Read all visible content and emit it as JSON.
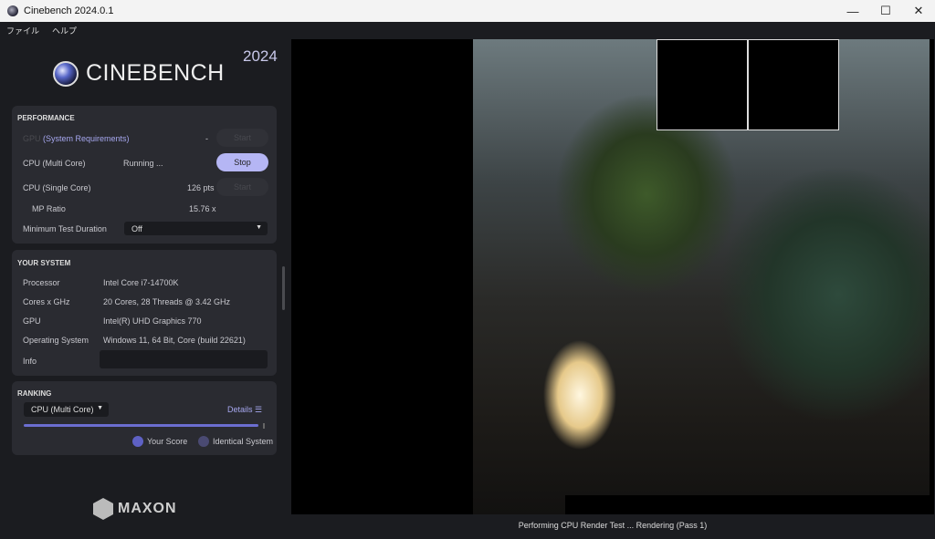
{
  "window": {
    "title": "Cinebench 2024.0.1",
    "minimize": "—",
    "maximize": "☐",
    "close": "✕"
  },
  "menu": [
    "ファイル",
    "ヘルプ"
  ],
  "brand": {
    "name": "CINEBENCH",
    "year": "2024",
    "footer": "MAXON"
  },
  "performance": {
    "heading": "PERFORMANCE",
    "gpu": {
      "label": "GPU",
      "link": "(System Requirements)",
      "value": "-",
      "button": "Start"
    },
    "multi": {
      "label": "CPU (Multi Core)",
      "value": "Running ...",
      "button": "Stop"
    },
    "single": {
      "label": "CPU (Single Core)",
      "value": "126 pts",
      "button": "Start"
    },
    "mp": {
      "label": "MP Ratio",
      "value": "15.76 x"
    },
    "duration": {
      "label": "Minimum Test Duration",
      "value": "Off"
    }
  },
  "system": {
    "heading": "YOUR SYSTEM",
    "rows": [
      {
        "label": "Processor",
        "value": "Intel Core i7-14700K"
      },
      {
        "label": "Cores x GHz",
        "value": "20 Cores, 28 Threads @ 3.42 GHz"
      },
      {
        "label": "GPU",
        "value": "Intel(R) UHD Graphics 770"
      },
      {
        "label": "Operating System",
        "value": "Windows 11, 64 Bit, Core (build 22621)"
      }
    ],
    "info_label": "Info",
    "info_value": ""
  },
  "ranking": {
    "heading": "RANKING",
    "select": "CPU (Multi Core)",
    "details": "Details",
    "legend": [
      "Your Score",
      "Identical System"
    ],
    "colors": [
      "#5e61c4",
      "#4a4a72"
    ]
  },
  "status": "Performing CPU Render Test ... Rendering (Pass 1)"
}
